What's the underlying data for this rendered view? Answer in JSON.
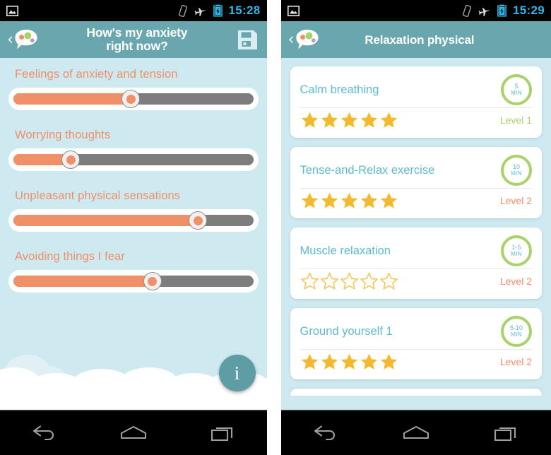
{
  "left": {
    "statusbar": {
      "image_icon": "image-icon",
      "vibrate_icon": "vibrate-icon",
      "airplane_icon": "airplane-mode-icon",
      "battery_icon": "battery-charging-icon",
      "clock": "15:28"
    },
    "appbar": {
      "back_label": "‹",
      "logo_icon": "app-logo-speech-bubble-icon",
      "title": "How's my anxiety right now?",
      "title_line1": "How's my anxiety",
      "title_line2": "right now?",
      "save_icon": "save-floppy-icon"
    },
    "sliders": [
      {
        "label": "Feelings of anxiety and tension",
        "value": 49
      },
      {
        "label": "Worrying thoughts",
        "value": 24
      },
      {
        "label": "Unpleasant physical sensations",
        "value": 77
      },
      {
        "label": "Avoiding things I fear",
        "value": 58
      }
    ],
    "info_button": {
      "label": "i",
      "icon": "info-icon"
    }
  },
  "right": {
    "statusbar": {
      "image_icon": "image-icon",
      "vibrate_icon": "vibrate-icon",
      "airplane_icon": "airplane-mode-icon",
      "battery_icon": "battery-charging-icon",
      "clock": "15:29"
    },
    "appbar": {
      "back_label": "‹",
      "logo_icon": "app-logo-speech-bubble-icon",
      "title": "Relaxation physical"
    },
    "cards": [
      {
        "title": "Calm breathing",
        "duration_num": "5",
        "duration_unit": "MIN",
        "stars": 5,
        "stars_filled": true,
        "level": "Level 1",
        "level_style": "lv1"
      },
      {
        "title": "Tense-and-Relax exercise",
        "duration_num": "10",
        "duration_unit": "MIN",
        "stars": 5,
        "stars_filled": true,
        "level": "Level 2",
        "level_style": "lv2"
      },
      {
        "title": "Muscle relaxation",
        "duration_num": "1-5",
        "duration_unit": "MIN",
        "stars": 5,
        "stars_filled": false,
        "level": "Level 2",
        "level_style": "lv2"
      },
      {
        "title": "Ground yourself 1",
        "duration_num": "5-10",
        "duration_unit": "MIN",
        "stars": 5,
        "stars_filled": true,
        "level": "Level 2",
        "level_style": "lv2"
      }
    ]
  },
  "navbar": {
    "back_icon": "nav-back-icon",
    "home_icon": "nav-home-icon",
    "recents_icon": "nav-recents-icon"
  },
  "colors": {
    "appbar": "#69a6ad",
    "sky": "#cfe9f1",
    "orange": "#ef9069",
    "teal_text": "#5bbcd0",
    "green": "#a8d26a",
    "star": "#f5b930",
    "track_gray": "#7d7d7d",
    "status_clock": "#33b5e5"
  }
}
